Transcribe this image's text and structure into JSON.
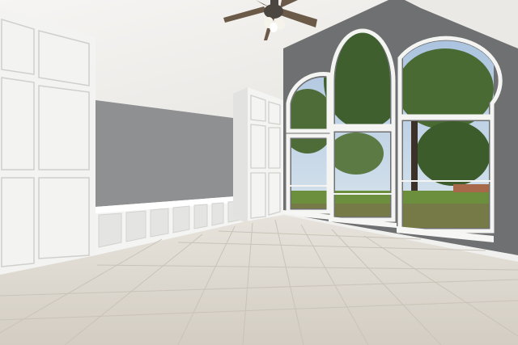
{
  "scene": {
    "kind": "interior photo",
    "colors": {
      "ceiling": "#f1f0ee",
      "accent_wall": "#6f7071",
      "side_wall": "#8e8f91",
      "white_trim": "#f4f4f2",
      "floor": "#d9d4cc",
      "grout": "#c4beb4",
      "sky": "#b8cbe0",
      "foliage": "#3f5f2e",
      "lawn": "#6b8f3c",
      "fan_blade": "#6b5a48",
      "fan_body": "#4c4640"
    },
    "icons": [
      "ceiling-fan-icon"
    ]
  }
}
